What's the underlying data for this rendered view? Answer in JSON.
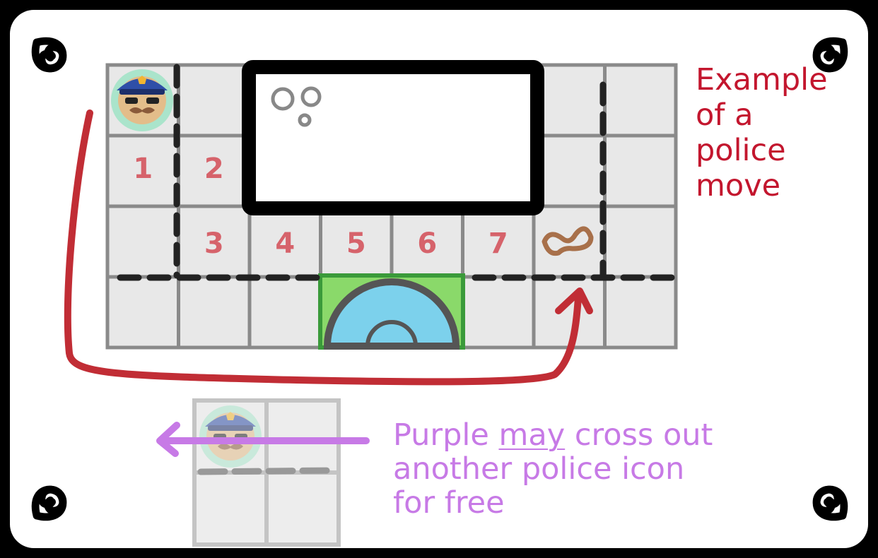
{
  "panel": {
    "colors": {
      "border": "#000000",
      "background": "#ffffff"
    },
    "corner_ornaments": [
      "swirl-ornament",
      "swirl-ornament",
      "swirl-ornament",
      "swirl-ornament"
    ]
  },
  "main_board": {
    "grid": {
      "rows": 4,
      "cols": 8,
      "cell_color": "#e8e8e8",
      "line_color": "#8a8a8a"
    },
    "police_token": {
      "icon": "police-officer-icon",
      "row": 1,
      "col": 1
    },
    "move_numbers": [
      {
        "label": "1",
        "row": 2,
        "col": 1
      },
      {
        "label": "2",
        "row": 2,
        "col": 2
      },
      {
        "label": "3",
        "row": 3,
        "col": 2
      },
      {
        "label": "4",
        "row": 3,
        "col": 3
      },
      {
        "label": "5",
        "row": 3,
        "col": 4
      },
      {
        "label": "6",
        "row": 3,
        "col": 5
      },
      {
        "label": "7",
        "row": 3,
        "col": 6
      }
    ],
    "mustache_mark": {
      "icon": "mustache-icon",
      "row": 3,
      "col": 7,
      "color": "#a8704a"
    },
    "building": {
      "icon": "building-block",
      "bubbles_icon": "bubbles-icon"
    },
    "fountain": {
      "icon": "fountain-icon",
      "border_color": "#3a9a3a"
    },
    "path_color": "#c12d35"
  },
  "note_red": {
    "lines": [
      "Example",
      "of a",
      "police",
      "move"
    ],
    "color": "#c3162e"
  },
  "mini_board": {
    "grid": {
      "rows": 2,
      "cols": 2
    },
    "police_token": {
      "icon": "police-officer-icon"
    },
    "arrow_color": "#c77ae6"
  },
  "note_purple": {
    "line1_before": "Purple ",
    "line1_underlined": "may",
    "line1_after": " cross out",
    "line2": "another police icon",
    "line3": "for free",
    "color": "#c77ae6"
  }
}
